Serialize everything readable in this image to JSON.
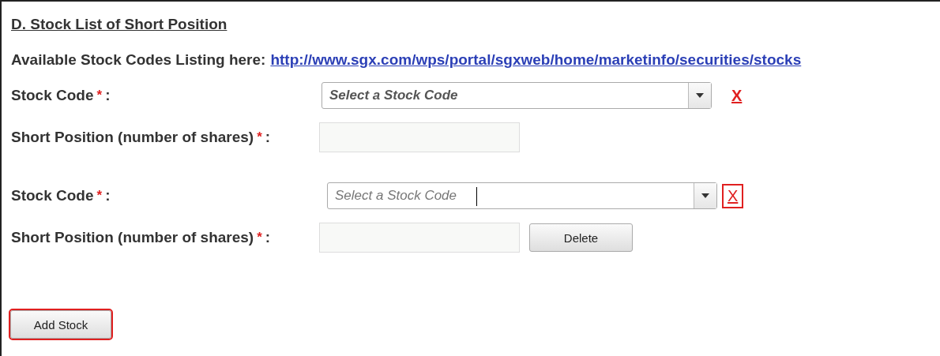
{
  "section_title": "D. Stock List of Short Position",
  "listing": {
    "label": "Available Stock Codes Listing here:",
    "link": "http://www.sgx.com/wps/portal/sgxweb/home/marketinfo/securities/stocks"
  },
  "entries": [
    {
      "stock_code_label": "Stock Code",
      "required_mark": "*",
      "separator": ":",
      "select": {
        "placeholder": "Select a Stock Code",
        "focused": false
      },
      "remove": {
        "label": "X",
        "highlighted": false
      },
      "short_position_label": "Short Position (number of shares)",
      "short_required_mark": "*",
      "short_separator": ":"
    },
    {
      "stock_code_label": "Stock Code",
      "required_mark": "*",
      "separator": ":",
      "select": {
        "placeholder": "Select a Stock Code",
        "focused": true
      },
      "remove": {
        "label": "X",
        "highlighted": true
      },
      "short_position_label": "Short Position (number of shares)",
      "short_required_mark": "*",
      "short_separator": ":",
      "delete_button": "Delete"
    }
  ],
  "add_button": {
    "label": "Add Stock",
    "highlighted": true
  }
}
